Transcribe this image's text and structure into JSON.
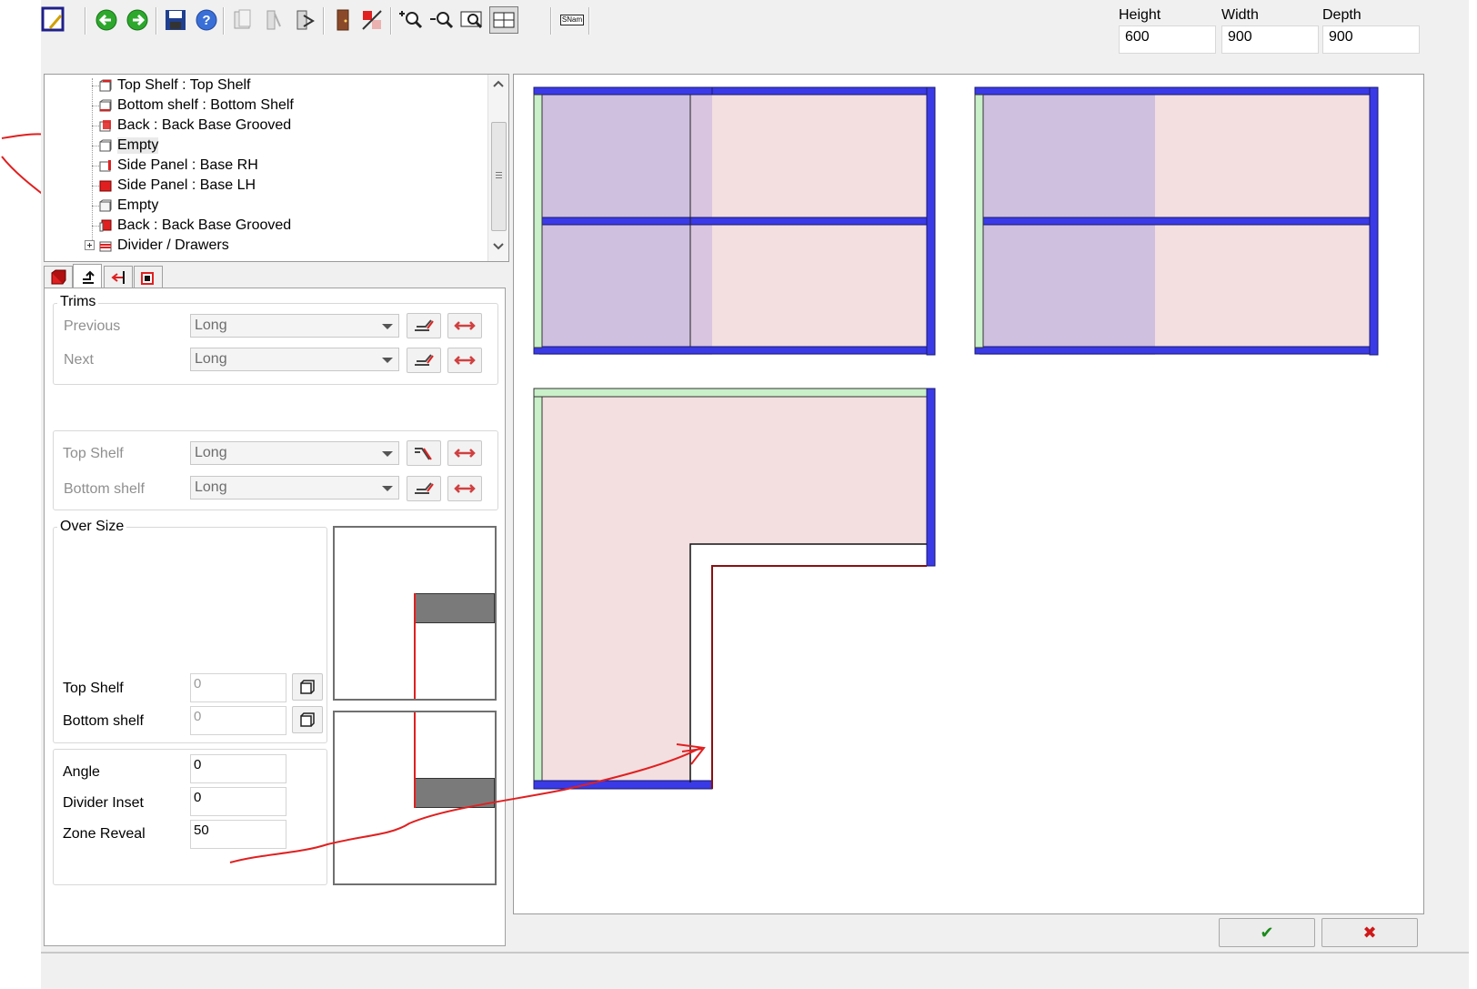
{
  "toolbar": {
    "icons": [
      "new-drawing-icon",
      "back-arrow-icon",
      "forward-arrow-icon",
      "save-icon",
      "help-icon",
      "panel-grey-icon",
      "panel-grey-2-icon",
      "panel-cut-icon",
      "door-icon",
      "delete-panel-icon",
      "zoom-in-icon",
      "zoom-out-icon",
      "zoom-window-icon",
      "grid-view-icon",
      "sname-icon"
    ],
    "sname_label": "SNam"
  },
  "dimensions": {
    "height_label": "Height",
    "height_value": "600",
    "width_label": "Width",
    "width_value": "900",
    "depth_label": "Depth",
    "depth_value": "900"
  },
  "tree": {
    "items": [
      {
        "label": "Top Shelf : Top Shelf",
        "icon": "shelf-icon"
      },
      {
        "label": "Bottom shelf : Bottom Shelf",
        "icon": "shelf-icon"
      },
      {
        "label": "Back : Back Base Grooved",
        "icon": "back-panel-icon"
      },
      {
        "label": "Empty",
        "icon": "empty-panel-icon"
      },
      {
        "label": "Side Panel : Base RH",
        "icon": "side-panel-icon"
      },
      {
        "label": "Side Panel : Base LH",
        "icon": "side-panel-red-icon"
      },
      {
        "label": "Empty",
        "icon": "empty-panel-icon"
      },
      {
        "label": "Back : Back Base Grooved",
        "icon": "back-panel-red-icon"
      },
      {
        "label": "Divider / Drawers",
        "icon": "drawers-icon"
      }
    ]
  },
  "tabs": [
    "cabinet-tab",
    "trims-tab",
    "inset-tab",
    "panel-tab"
  ],
  "trims": {
    "title": "Trims",
    "previous_label": "Previous",
    "previous_value": "Long",
    "next_label": "Next",
    "next_value": "Long"
  },
  "shelves": {
    "top_label": "Top Shelf",
    "top_value": "Long",
    "bottom_label": "Bottom shelf",
    "bottom_value": "Long"
  },
  "oversize": {
    "title": "Over Size",
    "top_label": "Top Shelf",
    "top_value": "0",
    "bottom_label": "Bottom shelf",
    "bottom_value": "0"
  },
  "settings": {
    "angle_label": "Angle",
    "angle_value": "0",
    "divider_inset_label": "Divider Inset",
    "divider_inset_value": "0",
    "zone_reveal_label": "Zone Reveal",
    "zone_reveal_value": "50"
  },
  "buttons": {
    "ok": "✔",
    "cancel": "✖"
  },
  "colors": {
    "panel_blue": "#3a3ae6",
    "zone_purple": "#cfc0e0",
    "zone_pink": "#f3dfe0",
    "side_green": "#c9f0c9",
    "annotation_red": "#e02020",
    "ok_green": "#1a8a1a",
    "cancel_red": "#d01818"
  }
}
